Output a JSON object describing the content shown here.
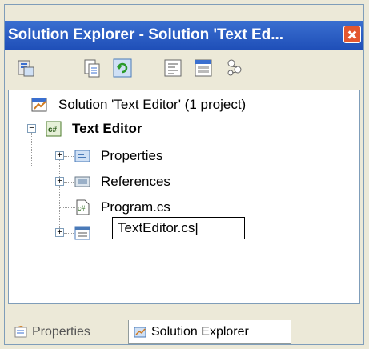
{
  "window": {
    "title": "Solution Explorer - Solution 'Text Ed...",
    "close_icon": "close-icon"
  },
  "toolbar": {
    "buttons": [
      {
        "name": "properties-button",
        "icon": "properties-icon"
      },
      {
        "name": "show-all-files-button",
        "icon": "show-all-files-icon"
      },
      {
        "name": "refresh-button",
        "icon": "refresh-icon"
      },
      {
        "name": "view-code-button",
        "icon": "view-code-icon"
      },
      {
        "name": "view-designer-button",
        "icon": "view-designer-icon"
      },
      {
        "name": "class-view-button",
        "icon": "class-view-icon"
      }
    ]
  },
  "tree": {
    "solution": {
      "label": "Solution 'Text Editor' (1 project)",
      "icon": "solution-icon"
    },
    "project": {
      "label": "Text Editor",
      "icon": "csharp-project-icon"
    },
    "items": [
      {
        "label": "Properties",
        "icon": "properties-folder-icon"
      },
      {
        "label": "References",
        "icon": "references-icon"
      },
      {
        "label": "Program.cs",
        "icon": "csharp-file-icon"
      },
      {
        "label": "TextEditor.cs",
        "icon": "form-file-icon",
        "editing": true
      }
    ]
  },
  "tabs": [
    {
      "label": "Properties",
      "icon": "properties-window-icon",
      "active": false
    },
    {
      "label": "Solution Explorer",
      "icon": "solution-explorer-icon",
      "active": true
    }
  ]
}
